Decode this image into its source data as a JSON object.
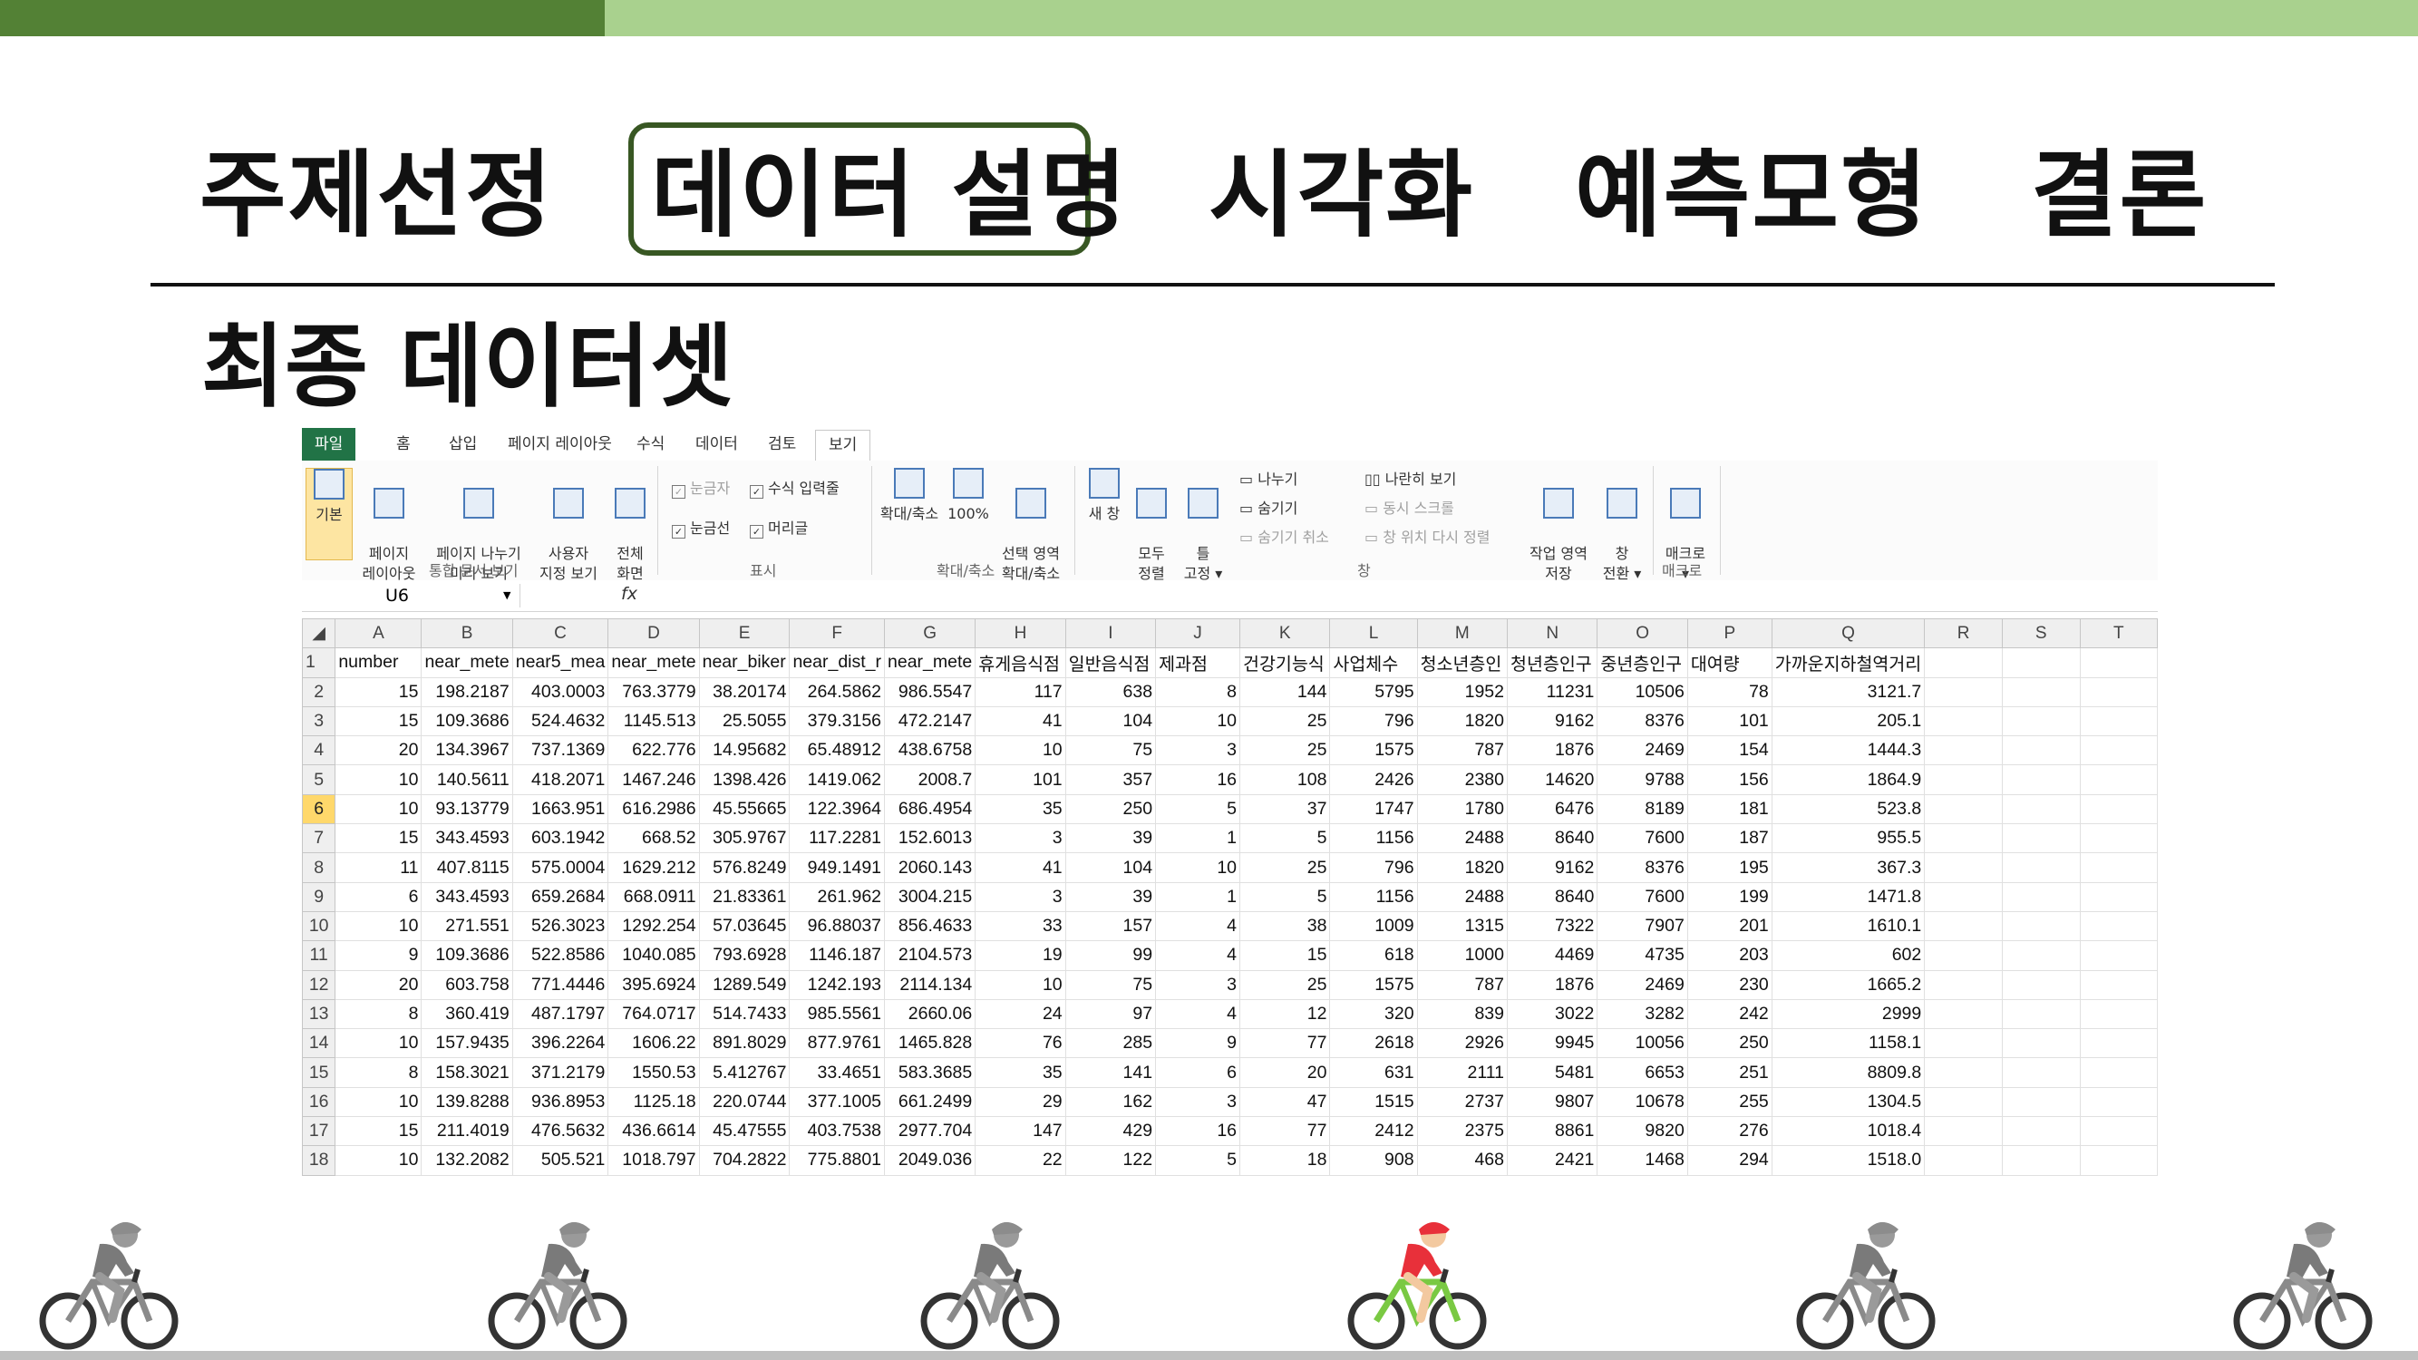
{
  "colors": {
    "accent_dark": "#538135",
    "accent_light": "#a9d18e",
    "active_border": "#385723",
    "active_rider": "#e8303a"
  },
  "nav": {
    "items": [
      "주제선정",
      "데이터 설명",
      "시각화",
      "예측모형",
      "결론"
    ],
    "active": "데이터 설명"
  },
  "subtitle": "최종 데이터셋",
  "excel": {
    "tabs": [
      "파일",
      "홈",
      "삽입",
      "페이지 레이아웃",
      "수식",
      "데이터",
      "검토",
      "보기"
    ],
    "selected_tab": "보기",
    "ribbon": {
      "normal": "기본",
      "page_layout": "페이지\n레이아웃",
      "page_break": "페이지 나누기\n미리 보기",
      "custom_view": "사용자\n지정 보기",
      "full_screen": "전체\n화면",
      "group_views": "통합 문서 보기",
      "ruler": "눈금자",
      "formula_bar": "수식 입력줄",
      "gridlines": "눈금선",
      "headings": "머리글",
      "group_show": "표시",
      "zoom": "확대/축소",
      "zoom100": "100%",
      "zoom_selection": "선택 영역\n확대/축소",
      "group_zoom": "확대/축소",
      "new_window": "새 창",
      "arrange_all": "모두\n정렬",
      "freeze": "틀\n고정 ▾",
      "split": "나누기",
      "hide": "숨기기",
      "unhide": "숨기기 취소",
      "side_by_side": "나란히 보기",
      "sync_scroll": "동시 스크롤",
      "reset_position": "창 위치 다시 정렬",
      "save_workspace": "작업 영역\n저장",
      "switch_windows": "창\n전환 ▾",
      "group_window": "창",
      "macros": "매크로\n▾",
      "group_macros": "매크로"
    },
    "name_box": "U6",
    "fx_icon": "fx",
    "columns": [
      "A",
      "B",
      "C",
      "D",
      "E",
      "F",
      "G",
      "H",
      "I",
      "J",
      "K",
      "L",
      "M",
      "N",
      "O",
      "P",
      "Q",
      "R",
      "S",
      "T"
    ],
    "header_row": [
      "number",
      "near_mete",
      "near5_mea",
      "near_mete",
      "near_biker",
      "near_dist_r",
      "near_mete",
      "휴게음식점",
      "일반음식점",
      "제과점",
      "건강기능식",
      "사업체수",
      "청소년층인",
      "청년층인구",
      "중년층인구",
      "대여량",
      "가까운지하철역거리",
      "",
      "",
      ""
    ],
    "rows": [
      [
        "2",
        "15",
        "198.2187",
        "403.0003",
        "763.3779",
        "38.20174",
        "264.5862",
        "986.5547",
        "117",
        "638",
        "8",
        "144",
        "5795",
        "1952",
        "11231",
        "10506",
        "78",
        "3121.7"
      ],
      [
        "3",
        "15",
        "109.3686",
        "524.4632",
        "1145.513",
        "25.5055",
        "379.3156",
        "472.2147",
        "41",
        "104",
        "10",
        "25",
        "796",
        "1820",
        "9162",
        "8376",
        "101",
        "205.1"
      ],
      [
        "4",
        "20",
        "134.3967",
        "737.1369",
        "622.776",
        "14.95682",
        "65.48912",
        "438.6758",
        "10",
        "75",
        "3",
        "25",
        "1575",
        "787",
        "1876",
        "2469",
        "154",
        "1444.3"
      ],
      [
        "5",
        "10",
        "140.5611",
        "418.2071",
        "1467.246",
        "1398.426",
        "1419.062",
        "2008.7",
        "101",
        "357",
        "16",
        "108",
        "2426",
        "2380",
        "14620",
        "9788",
        "156",
        "1864.9"
      ],
      [
        "6",
        "10",
        "93.13779",
        "1663.951",
        "616.2986",
        "45.55665",
        "122.3964",
        "686.4954",
        "35",
        "250",
        "5",
        "37",
        "1747",
        "1780",
        "6476",
        "8189",
        "181",
        "523.8"
      ],
      [
        "7",
        "15",
        "343.4593",
        "603.1942",
        "668.52",
        "305.9767",
        "117.2281",
        "152.6013",
        "3",
        "39",
        "1",
        "5",
        "1156",
        "2488",
        "8640",
        "7600",
        "187",
        "955.5"
      ],
      [
        "8",
        "11",
        "407.8115",
        "575.0004",
        "1629.212",
        "576.8249",
        "949.1491",
        "2060.143",
        "41",
        "104",
        "10",
        "25",
        "796",
        "1820",
        "9162",
        "8376",
        "195",
        "367.3"
      ],
      [
        "9",
        "6",
        "343.4593",
        "659.2684",
        "668.0911",
        "21.83361",
        "261.962",
        "3004.215",
        "3",
        "39",
        "1",
        "5",
        "1156",
        "2488",
        "8640",
        "7600",
        "199",
        "1471.8"
      ],
      [
        "10",
        "10",
        "271.551",
        "526.3023",
        "1292.254",
        "57.03645",
        "96.88037",
        "856.4633",
        "33",
        "157",
        "4",
        "38",
        "1009",
        "1315",
        "7322",
        "7907",
        "201",
        "1610.1"
      ],
      [
        "11",
        "9",
        "109.3686",
        "522.8586",
        "1040.085",
        "793.6928",
        "1146.187",
        "2104.573",
        "19",
        "99",
        "4",
        "15",
        "618",
        "1000",
        "4469",
        "4735",
        "203",
        "602"
      ],
      [
        "12",
        "20",
        "603.758",
        "771.4446",
        "395.6924",
        "1289.549",
        "1242.193",
        "2114.134",
        "10",
        "75",
        "3",
        "25",
        "1575",
        "787",
        "1876",
        "2469",
        "230",
        "1665.2"
      ],
      [
        "13",
        "8",
        "360.419",
        "487.1797",
        "764.0717",
        "514.7433",
        "985.5561",
        "2660.06",
        "24",
        "97",
        "4",
        "12",
        "320",
        "839",
        "3022",
        "3282",
        "242",
        "2999"
      ],
      [
        "14",
        "10",
        "157.9435",
        "396.2264",
        "1606.22",
        "891.8029",
        "877.9761",
        "1465.828",
        "76",
        "285",
        "9",
        "77",
        "2618",
        "2926",
        "9945",
        "10056",
        "250",
        "1158.1"
      ],
      [
        "15",
        "8",
        "158.3021",
        "371.2179",
        "1550.53",
        "5.412767",
        "33.4651",
        "583.3685",
        "35",
        "141",
        "6",
        "20",
        "631",
        "2111",
        "5481",
        "6653",
        "251",
        "8809.8"
      ],
      [
        "16",
        "10",
        "139.8288",
        "936.8953",
        "1125.18",
        "220.0744",
        "377.1005",
        "661.2499",
        "29",
        "162",
        "3",
        "47",
        "1515",
        "2737",
        "9807",
        "10678",
        "255",
        "1304.5"
      ],
      [
        "17",
        "15",
        "211.4019",
        "476.5632",
        "436.6614",
        "45.47555",
        "403.7538",
        "2977.704",
        "147",
        "429",
        "16",
        "77",
        "2412",
        "2375",
        "8861",
        "9820",
        "276",
        "1018.4"
      ],
      [
        "18",
        "10",
        "132.2082",
        "505.521",
        "1018.797",
        "704.2822",
        "775.8801",
        "2049.036",
        "22",
        "122",
        "5",
        "18",
        "908",
        "468",
        "2421",
        "1468",
        "294",
        "1518.0"
      ]
    ]
  },
  "icons": {
    "rider": "cyclist-icon",
    "active_rider": "cyclist-active-icon"
  }
}
